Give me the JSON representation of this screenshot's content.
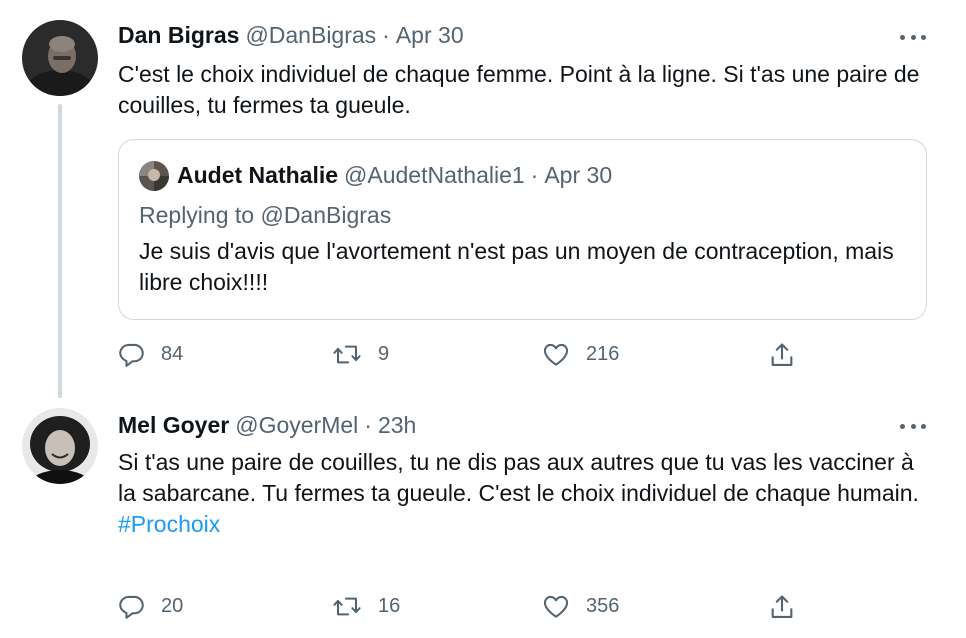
{
  "tweets": [
    {
      "name": "Dan Bigras",
      "handle": "@DanBigras",
      "dot": "·",
      "time": "Apr 30",
      "text": "C'est le choix individuel de chaque femme. Point à la ligne. Si t'as une paire de couilles, tu fermes ta gueule.",
      "quote": {
        "name": "Audet Nathalie",
        "handle": "@AudetNathalie1",
        "dot": "·",
        "time": "Apr 30",
        "replying_prefix": "Replying to ",
        "replying_to": "@DanBigras",
        "text": "Je suis d'avis que l'avortement n'est pas un moyen de contraception, mais libre choix!!!!"
      },
      "replies": "84",
      "retweets": "9",
      "likes": "216"
    },
    {
      "name": "Mel Goyer",
      "handle": "@GoyerMel",
      "dot": "·",
      "time": "23h",
      "text": "Si t'as une paire de couilles, tu ne dis pas aux autres que tu vas les vacciner à la sabarcane. Tu fermes ta gueule. C'est le choix individuel de chaque humain.",
      "hashtag": "#Prochoix",
      "replies": "20",
      "retweets": "16",
      "likes": "356"
    }
  ],
  "icons": {
    "reply": "reply-icon",
    "retweet": "retweet-icon",
    "like": "heart-icon",
    "share": "share-icon",
    "more": "more-options-icon"
  },
  "colors": {
    "text": "#0f1419",
    "secondary": "#536471",
    "link": "#1d9bf0",
    "border": "#cfd9de"
  }
}
